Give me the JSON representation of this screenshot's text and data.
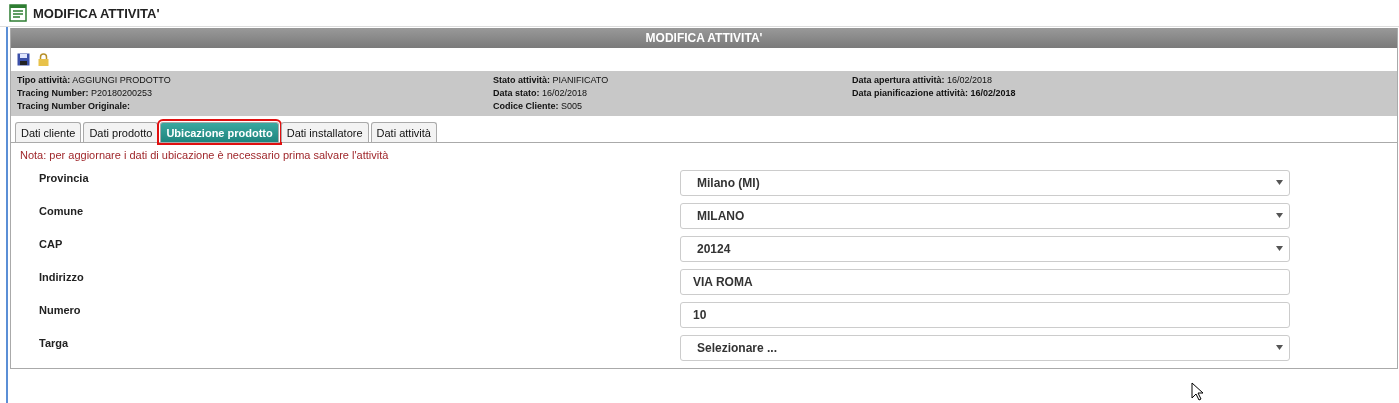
{
  "window": {
    "title": "MODIFICA ATTIVITA'"
  },
  "panel": {
    "title": "MODIFICA ATTIVITA'"
  },
  "info_columns": [
    [
      "**Tipo attività:** AGGIUNGI PRODOTTO",
      "**Tracing Number:** P20180200253",
      "**Tracing Number Originale:**"
    ],
    [
      "**Stato attività:** PIANIFICATO",
      "**Data stato:** 16/02/2018",
      "**Codice Cliente:** S005"
    ],
    [
      "**Data apertura attività:** 16/02/2018",
      "**Data pianificazione attività: 16/02/2018**"
    ]
  ],
  "tabs": [
    {
      "label": "Dati cliente",
      "selected": false
    },
    {
      "label": "Dati prodotto",
      "selected": false
    },
    {
      "label": "Ubicazione prodotto",
      "selected": true
    },
    {
      "label": "Dati installatore",
      "selected": false
    },
    {
      "label": "Dati attività",
      "selected": false
    }
  ],
  "note": "Nota: per aggiornare i dati di ubicazione è necessario prima salvare l'attività",
  "fields": [
    {
      "label": "Provincia",
      "kind": "select",
      "value": "Milano (MI)"
    },
    {
      "label": "Comune",
      "kind": "select",
      "value": "MILANO"
    },
    {
      "label": "CAP",
      "kind": "select",
      "value": "20124"
    },
    {
      "label": "Indirizzo",
      "kind": "text",
      "value": "VIA ROMA"
    },
    {
      "label": "Numero",
      "kind": "text",
      "value": "10"
    },
    {
      "label": "Targa",
      "kind": "select",
      "value": "Selezionare ..."
    }
  ]
}
